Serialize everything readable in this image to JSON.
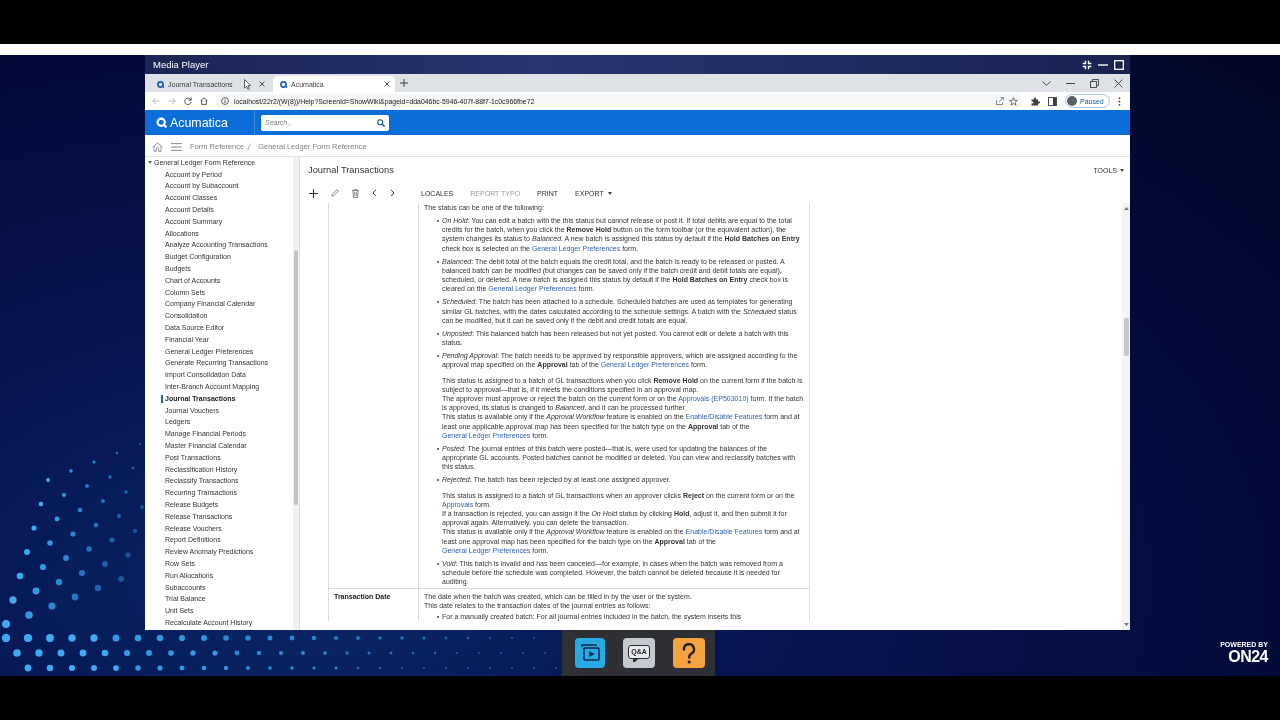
{
  "player": {
    "title": "Media Player"
  },
  "browser": {
    "tabs": [
      {
        "title": "Journal Transactions",
        "selected": false
      },
      {
        "title": "Acumatica",
        "selected": true
      }
    ],
    "url": "localhost/22r2/(W(8))/Help?ScreenId=ShowWiki&pageid=dda046bc-5946-407f-88f7-1c0c966fbe72",
    "profile": "Paused"
  },
  "app": {
    "logo": "Acumatica",
    "search": {
      "placeholder": "Search..."
    }
  },
  "breadcrumb": [
    "Form Reference",
    "General Ledger Form Reference"
  ],
  "sidebar": {
    "tree": [
      {
        "label": "General Ledger Form Reference",
        "expanded": true,
        "selected": false,
        "children": [
          {
            "label": "Account by Period",
            "selected": false
          },
          {
            "label": "Account by Subaccount",
            "selected": false
          },
          {
            "label": "Account Classes",
            "selected": false
          },
          {
            "label": "Account Details",
            "selected": false
          },
          {
            "label": "Account Summary",
            "selected": false
          },
          {
            "label": "Allocations",
            "selected": false
          },
          {
            "label": "Analyze Accounting Transactions",
            "selected": false
          },
          {
            "label": "Budget Configuration",
            "selected": false
          },
          {
            "label": "Budgets",
            "selected": false
          },
          {
            "label": "Chart of Accounts",
            "selected": false
          },
          {
            "label": "Column Sets",
            "selected": false
          },
          {
            "label": "Company Financial Calendar",
            "selected": false
          },
          {
            "label": "Consolidation",
            "selected": false
          },
          {
            "label": "Data Source Editor",
            "selected": false
          },
          {
            "label": "Financial Year",
            "selected": false
          },
          {
            "label": "General Ledger Preferences",
            "selected": false
          },
          {
            "label": "Generate Recurring Transactions",
            "selected": false
          },
          {
            "label": "Import Consolidation Data",
            "selected": false
          },
          {
            "label": "Inter-Branch Account Mapping",
            "selected": false
          },
          {
            "label": "Journal Transactions",
            "selected": true
          },
          {
            "label": "Journal Vouchers",
            "selected": false
          },
          {
            "label": "Ledgers",
            "selected": false
          },
          {
            "label": "Manage Financial Periods",
            "selected": false
          },
          {
            "label": "Master Financial Calendar",
            "selected": false
          },
          {
            "label": "Post Transactions",
            "selected": false
          },
          {
            "label": "Reclassification History",
            "selected": false
          },
          {
            "label": "Reclassify Transactions",
            "selected": false
          },
          {
            "label": "Recurring Transactions",
            "selected": false
          },
          {
            "label": "Release Budgets",
            "selected": false
          },
          {
            "label": "Release Transactions",
            "selected": false
          },
          {
            "label": "Release Vouchers",
            "selected": false
          },
          {
            "label": "Report Definitions",
            "selected": false
          },
          {
            "label": "Review Anomaly Predictions",
            "selected": false
          },
          {
            "label": "Row Sets",
            "selected": false
          },
          {
            "label": "Run Allocations",
            "selected": false
          },
          {
            "label": "Subaccounts",
            "selected": false
          },
          {
            "label": "Trial Balance",
            "selected": false
          },
          {
            "label": "Unit Sets",
            "selected": false
          },
          {
            "label": "Recalculate Account History",
            "selected": false
          }
        ]
      }
    ]
  },
  "page": {
    "title": "Journal Transactions",
    "tools": "TOOLS",
    "toolbar": [
      {
        "label": "LOCALES",
        "disabled": false,
        "menu": false
      },
      {
        "label": "REPORT TYPO",
        "disabled": true,
        "menu": false
      },
      {
        "label": "PRINT",
        "disabled": false,
        "menu": false
      },
      {
        "label": "EXPORT",
        "disabled": false,
        "menu": true
      }
    ],
    "table": {
      "rows": [
        {
          "blocks": [
            {
              "kind": "line",
              "parts": [
                {
                  "kind": "text",
                  "text": "The status can be one of the following:"
                }
              ]
            },
            {
              "kind": "bullet",
              "parts": [
                {
                  "kind": "text",
                  "text": "*On Hold*: You can edit a batch with the this status but cannot release or post it. If total debits are equal to the total credits for the batch, when you click the **Remove Hold** button on the form toolbar (or the equivalent action), the system changes its status to *Balanced*. A new batch is assigned this status by default if the **Hold Batches on Entry** check box is selected on the "
                },
                {
                  "kind": "link",
                  "text": "General Ledger Preferences"
                },
                {
                  "kind": "text",
                  "text": " form."
                }
              ]
            },
            {
              "kind": "bullet",
              "parts": [
                {
                  "kind": "text",
                  "text": "*Balanced*: The debit total of the batch equals the credit total, and the batch is ready to be released or posted. A balanced batch can be modified (but changes can be saved only if the batch credit and debit totals are equal), scheduled, or deleted. A new batch is assigned this status by default if the **Hold Batches on Entry** check box is cleared on the "
                },
                {
                  "kind": "link",
                  "text": "General Ledger Preferences"
                },
                {
                  "kind": "text",
                  "text": " form."
                }
              ]
            },
            {
              "kind": "bullet",
              "parts": [
                {
                  "kind": "text",
                  "text": "*Scheduled*: The batch has been attached to a schedule. Scheduled batches are used as templates for generating similar GL batches, with the dates calculated according to the schedule settings. A batch with the *Scheduled* status can be modified, but it can be saved only if the debit and credit totals are equal."
                }
              ]
            },
            {
              "kind": "bullet",
              "parts": [
                {
                  "kind": "text",
                  "text": "*Unposted*: This balanced batch has been released but not yet posted. You cannot edit or delete a batch with this status."
                }
              ]
            },
            {
              "kind": "bullet",
              "parts": [
                {
                  "kind": "text",
                  "text": "*Pending Approval*: The batch needs to be approved by responsible approvers, which are assigned according to the approval map specified on the **Approval** tab of the "
                },
                {
                  "kind": "link",
                  "text": "General Ledger Preferences"
                },
                {
                  "kind": "text",
                  "text": " form."
                }
              ],
              "note": [
                {
                  "parts": [
                    {
                      "kind": "text",
                      "text": "This status is assigned to a batch of GL transactions when you click **Remove Hold** on the current form if the batch is subject to approval—that is, if it meets the conditions specified in an approval map."
                    }
                  ]
                },
                {
                  "parts": [
                    {
                      "kind": "text",
                      "text": "The approver must approve or reject the batch on the current form or on the "
                    },
                    {
                      "kind": "link",
                      "text": "Approvals (EP503010)"
                    },
                    {
                      "kind": "text",
                      "text": " form. If the batch is approved, its status is changed to *Balanced*, and it can be processed further."
                    }
                  ]
                },
                {
                  "parts": [
                    {
                      "kind": "text",
                      "text": "This status is available only if the *Approval Workflow* feature is enabled on the "
                    },
                    {
                      "kind": "link",
                      "text": "Enable/Disable Features"
                    },
                    {
                      "kind": "text",
                      "text": " form and at least one applicable approval map has been specified for the batch type on the **Approval** tab of the "
                    },
                    {
                      "kind": "link",
                      "text": "General Ledger Preferences"
                    },
                    {
                      "kind": "text",
                      "text": " form."
                    }
                  ]
                }
              ]
            },
            {
              "kind": "bullet",
              "parts": [
                {
                  "kind": "text",
                  "text": "*Posted*: The journal entries of this batch were posted—that is, were used for updating the balances of the appropriate GL accounts. Posted batches cannot be modified or deleted. You can view and reclassify batches with this status."
                }
              ]
            },
            {
              "kind": "bullet",
              "parts": [
                {
                  "kind": "text",
                  "text": "*Rejected*: The batch has been rejected by at least one assigned approver."
                }
              ],
              "note": [
                {
                  "parts": [
                    {
                      "kind": "text",
                      "text": "This status is assigned to a batch of GL transactions when an approver clicks **Reject** on the current form or on the "
                    },
                    {
                      "kind": "link",
                      "text": "Approvals"
                    },
                    {
                      "kind": "text",
                      "text": " form."
                    }
                  ]
                },
                {
                  "parts": [
                    {
                      "kind": "text",
                      "text": "If a transaction is rejected, you can assign it the *On Hold* status by clicking **Hold**, adjust it, and then submit it for approval again. Alternatively, you can delete the transaction."
                    }
                  ]
                },
                {
                  "parts": [
                    {
                      "kind": "text",
                      "text": "This status is available only if the *Approval Workflow* feature is enabled on the "
                    },
                    {
                      "kind": "link",
                      "text": "Enable/Disable Features"
                    },
                    {
                      "kind": "text",
                      "text": " form and at least one approval map has been specified for the batch type on the **Approval** tab of the "
                    },
                    {
                      "kind": "link",
                      "text": "General Ledger Preferences"
                    },
                    {
                      "kind": "text",
                      "text": " form."
                    }
                  ]
                }
              ]
            },
            {
              "kind": "bullet",
              "parts": [
                {
                  "kind": "text",
                  "text": "*Void*: This batch is invalid and has been canceled—for example, in cases when the batch was removed from a schedule before the schedule was completed. However, the batch cannot be deleted because it is needed for auditing."
                }
              ]
            }
          ]
        },
        {
          "label": "Transaction Date",
          "blocks": [
            {
              "kind": "line",
              "parts": [
                {
                  "kind": "text",
                  "text": "The date when the batch was created, which can be filled in by the user or the system."
                }
              ]
            },
            {
              "kind": "line",
              "parts": [
                {
                  "kind": "text",
                  "text": "This date relates to the transaction dates of the journal entries as follows:"
                }
              ]
            },
            {
              "kind": "bullet",
              "parts": [
                {
                  "kind": "text",
                  "text": "For a manually created batch: For all journal entries included in the batch, the system inserts this"
                }
              ]
            }
          ]
        }
      ]
    }
  },
  "dock": [
    {
      "kind": "media"
    },
    {
      "kind": "qa",
      "label": "Q&A"
    },
    {
      "kind": "help"
    }
  ],
  "branding": {
    "caption": "POWERED BY",
    "logo": "ON24"
  }
}
